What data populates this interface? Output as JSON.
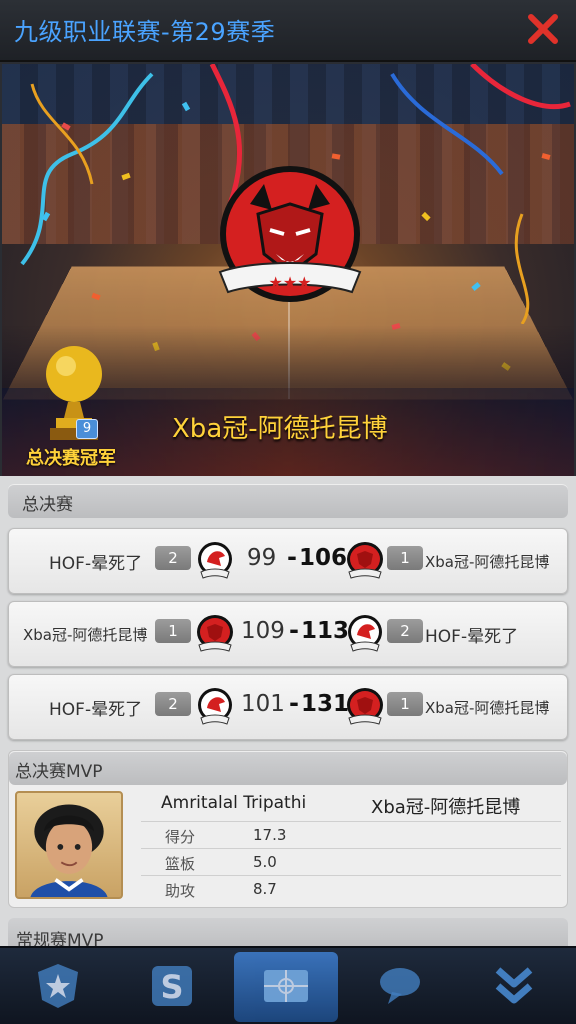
{
  "header": {
    "title": "九级职业联赛-第29赛季",
    "close_icon": "close-x-icon"
  },
  "hero": {
    "champion_name": "Xba冠-阿德托昆博",
    "trophy_count": "9",
    "trophy_label": "总决赛冠军",
    "logo_stars": "★★★"
  },
  "finals": {
    "section_title": "总决赛",
    "matches": [
      {
        "left_team": "HOF-晕死了",
        "left_seed": "2",
        "left_score": "99",
        "right_score": "106",
        "right_seed": "1",
        "right_team": "Xba冠-阿德托昆博"
      },
      {
        "left_team": "Xba冠-阿德托昆博",
        "left_seed": "1",
        "left_score": "109",
        "right_score": "113",
        "right_seed": "2",
        "right_team": "HOF-晕死了"
      },
      {
        "left_team": "HOF-晕死了",
        "left_seed": "2",
        "left_score": "101",
        "right_score": "131",
        "right_seed": "1",
        "right_team": "Xba冠-阿德托昆博"
      }
    ],
    "dash": "-"
  },
  "mvp": {
    "section_title": "总决赛MVP",
    "player_name": "Amritalal Tripathi",
    "team": "Xba冠-阿德托昆博",
    "stats": [
      {
        "label": "得分",
        "value": "17.3"
      },
      {
        "label": "篮板",
        "value": "5.0"
      },
      {
        "label": "助攻",
        "value": "8.7"
      }
    ]
  },
  "next_section": {
    "title": "常规赛MVP"
  },
  "colors": {
    "title_blue": "#4aa3ff",
    "gold": "#ffd23a",
    "close_red": "#e0322a",
    "logo_red": "#d42020"
  }
}
